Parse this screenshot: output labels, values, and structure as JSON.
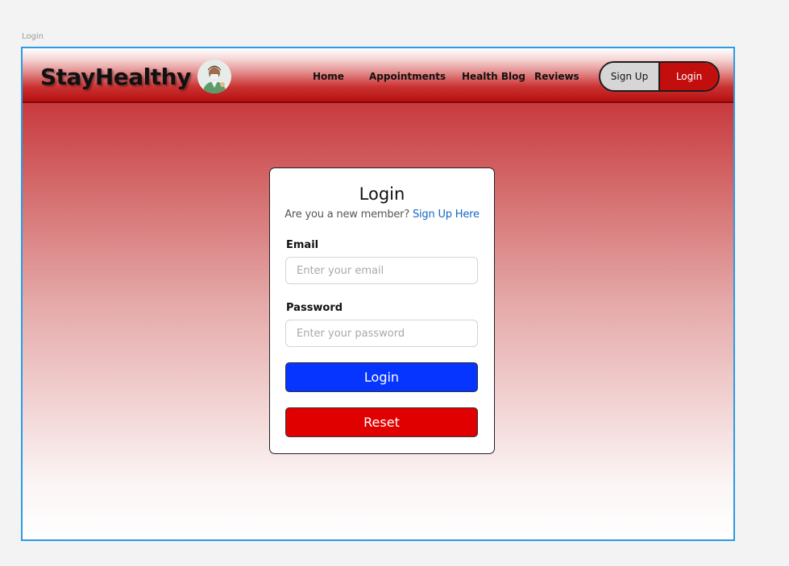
{
  "frame_label": "Login",
  "navbar": {
    "brand": "StayHealthy",
    "links": [
      {
        "label": "Home"
      },
      {
        "label": "Appointments"
      },
      {
        "label": "Health Blog"
      },
      {
        "label": "Reviews"
      }
    ],
    "signup_label": "Sign Up",
    "login_label": "Login"
  },
  "form": {
    "title": "Login",
    "subtitle": "Are you a new member?",
    "signup_link": "Sign Up Here",
    "email_label": "Email",
    "email_placeholder": "Enter your email",
    "email_value": "",
    "password_label": "Password",
    "password_placeholder": "Enter your password",
    "password_value": "",
    "login_button": "Login",
    "reset_button": "Reset"
  },
  "colors": {
    "brand_red": "#c1252a",
    "login_button": "#0535ff",
    "reset_button": "#e10000",
    "link": "#1267c4",
    "frame_border": "#2b9be4"
  },
  "icons": {
    "avatar": "doctor-avatar-icon"
  }
}
